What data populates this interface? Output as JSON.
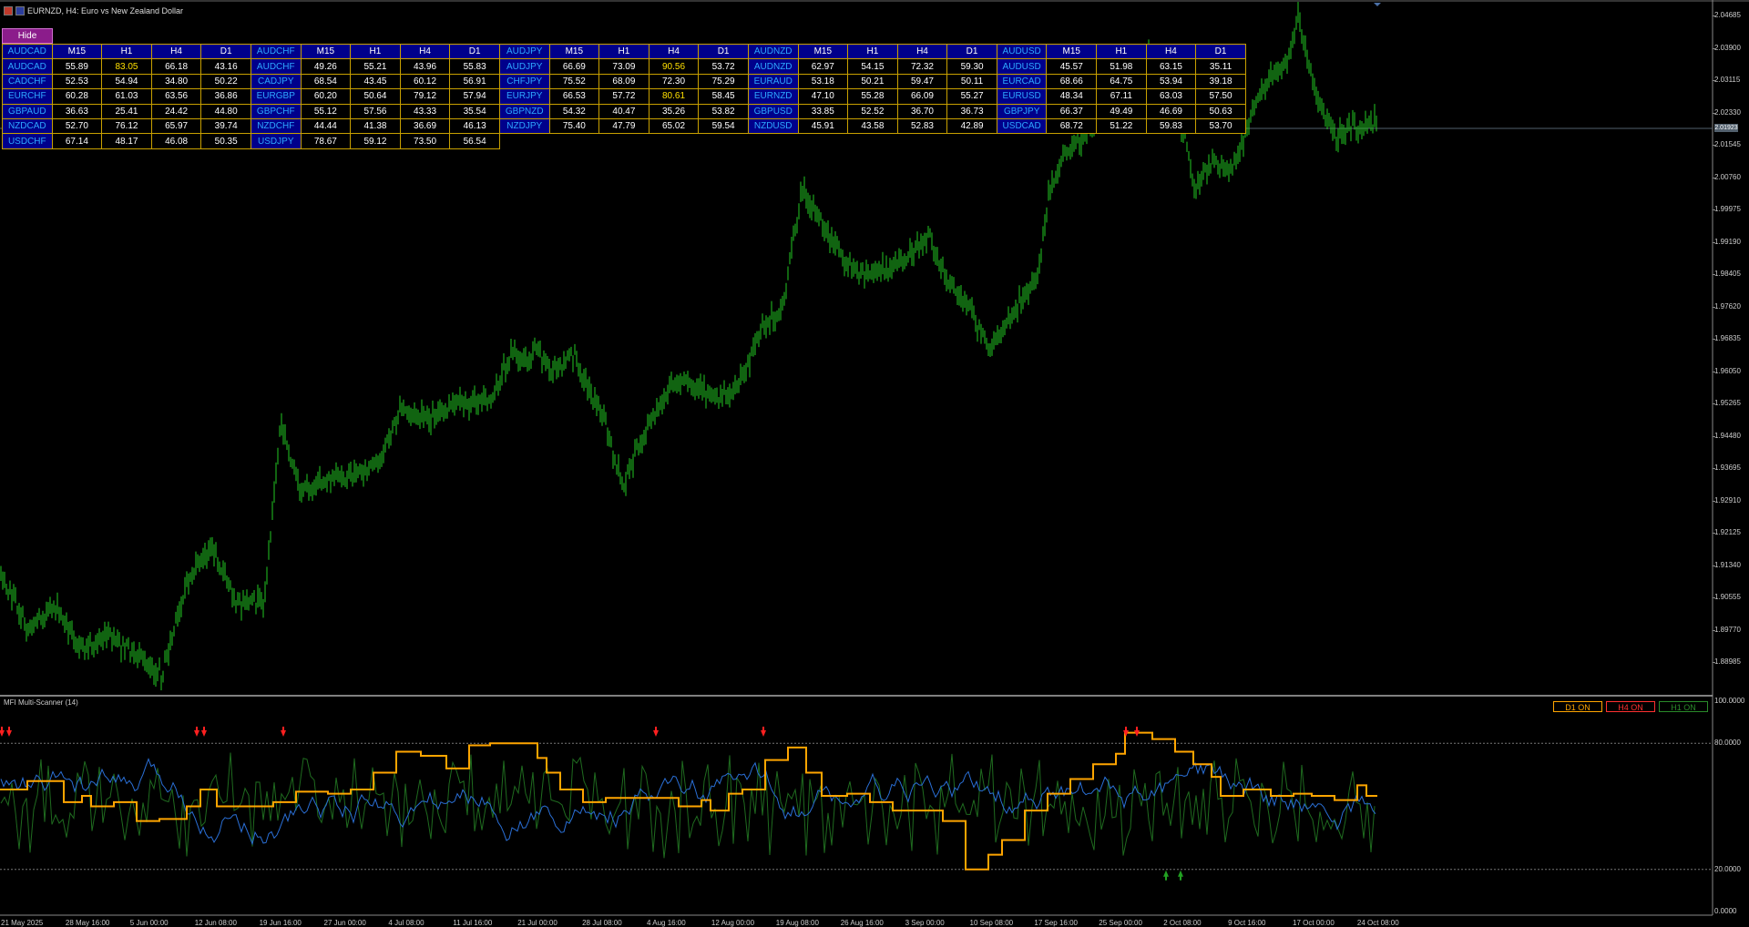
{
  "window": {
    "title": "EURNZD, H4:  Euro vs New Zealand Dollar"
  },
  "hide_button": "Hide",
  "scanner": {
    "header": [
      "AUDCAD",
      "M15",
      "H1",
      "H4",
      "D1",
      "AUDCHF",
      "M15",
      "H1",
      "H4",
      "D1",
      "AUDJPY",
      "M15",
      "H1",
      "H4",
      "D1",
      "AUDNZD",
      "M15",
      "H1",
      "H4",
      "D1",
      "AUDUSD",
      "M15",
      "H1",
      "H4",
      "D1"
    ],
    "rows": [
      [
        "AUDCAD",
        "55.89",
        "83.05",
        "66.18",
        "43.16",
        "AUDCHF",
        "49.26",
        "55.21",
        "43.96",
        "55.83",
        "AUDJPY",
        "66.69",
        "73.09",
        "90.56",
        "53.72",
        "AUDNZD",
        "62.97",
        "54.15",
        "72.32",
        "59.30",
        "AUDUSD",
        "45.57",
        "51.98",
        "63.15",
        "35.11"
      ],
      [
        "CADCHF",
        "52.53",
        "54.94",
        "34.80",
        "50.22",
        "CADJPY",
        "68.54",
        "43.45",
        "60.12",
        "56.91",
        "CHFJPY",
        "75.52",
        "68.09",
        "72.30",
        "75.29",
        "EURAUD",
        "53.18",
        "50.21",
        "59.47",
        "50.11",
        "EURCAD",
        "68.66",
        "64.75",
        "53.94",
        "39.18"
      ],
      [
        "EURCHF",
        "60.28",
        "61.03",
        "63.56",
        "36.86",
        "EURGBP",
        "60.20",
        "50.64",
        "79.12",
        "57.94",
        "EURJPY",
        "66.53",
        "57.72",
        "80.61",
        "58.45",
        "EURNZD",
        "47.10",
        "55.28",
        "66.09",
        "55.27",
        "EURUSD",
        "48.34",
        "67.11",
        "63.03",
        "57.50"
      ],
      [
        "GBPAUD",
        "36.63",
        "25.41",
        "24.42",
        "44.80",
        "GBPCHF",
        "55.12",
        "57.56",
        "43.33",
        "35.54",
        "GBPNZD",
        "54.32",
        "40.47",
        "35.26",
        "53.82",
        "GBPUSD",
        "33.85",
        "52.52",
        "36.70",
        "36.73",
        "GBPJPY",
        "66.37",
        "49.49",
        "46.69",
        "50.63"
      ],
      [
        "NZDCAD",
        "52.70",
        "76.12",
        "65.97",
        "39.74",
        "NZDCHF",
        "44.44",
        "41.38",
        "36.69",
        "46.13",
        "NZDJPY",
        "75.40",
        "47.79",
        "65.02",
        "59.54",
        "NZDUSD",
        "45.91",
        "43.58",
        "52.83",
        "42.89",
        "USDCAD",
        "68.72",
        "51.22",
        "59.83",
        "53.70"
      ],
      [
        "USDCHF",
        "67.14",
        "48.17",
        "46.08",
        "50.35",
        "USDJPY",
        "78.67",
        "59.12",
        "73.50",
        "56.54"
      ]
    ],
    "highlighted": [
      "83.05",
      "90.56",
      "80.61"
    ]
  },
  "price_axis": [
    "2.04685",
    "2.03900",
    "2.03115",
    "2.02330",
    "2.01545",
    "2.00760",
    "1.99975",
    "1.99190",
    "1.98405",
    "1.97620",
    "1.96835",
    "1.96050",
    "1.95265",
    "1.94480",
    "1.93695",
    "1.92910",
    "1.92125",
    "1.91340",
    "1.90555",
    "1.89770",
    "1.88985"
  ],
  "current_price": "2.01923",
  "indicator": {
    "title": "MFI Multi-Scanner (14)",
    "axis": [
      "100.0000",
      "80.0000",
      "20.0000",
      "0.0000"
    ],
    "buttons": {
      "d1": "D1 ON",
      "h4": "H4 ON",
      "h1": "H1 ON"
    }
  },
  "time_axis": [
    "21 May 2025",
    "28 May 16:00",
    "5 Jun 00:00",
    "12 Jun 08:00",
    "19 Jun 16:00",
    "27 Jun 00:00",
    "4 Jul 08:00",
    "11 Jul 16:00",
    "21 Jul 00:00",
    "28 Jul 08:00",
    "4 Aug 16:00",
    "12 Aug 00:00",
    "19 Aug 08:00",
    "26 Aug 16:00",
    "3 Sep 00:00",
    "10 Sep 08:00",
    "17 Sep 16:00",
    "25 Sep 00:00",
    "2 Oct 08:00",
    "9 Oct 16:00",
    "17 Oct 00:00",
    "24 Oct 08:00"
  ],
  "colors": {
    "candle": "#22c822",
    "d1": "#ffa500",
    "h4": "#2a6fd6",
    "h1": "#1f6b1f",
    "arrow_down": "#ff2020",
    "arrow_up": "#22a022",
    "header_bg": "#00008b",
    "pair_text": "#2ea8ff",
    "grid_border": "#c8a000",
    "highlight": "#ffe000"
  }
}
